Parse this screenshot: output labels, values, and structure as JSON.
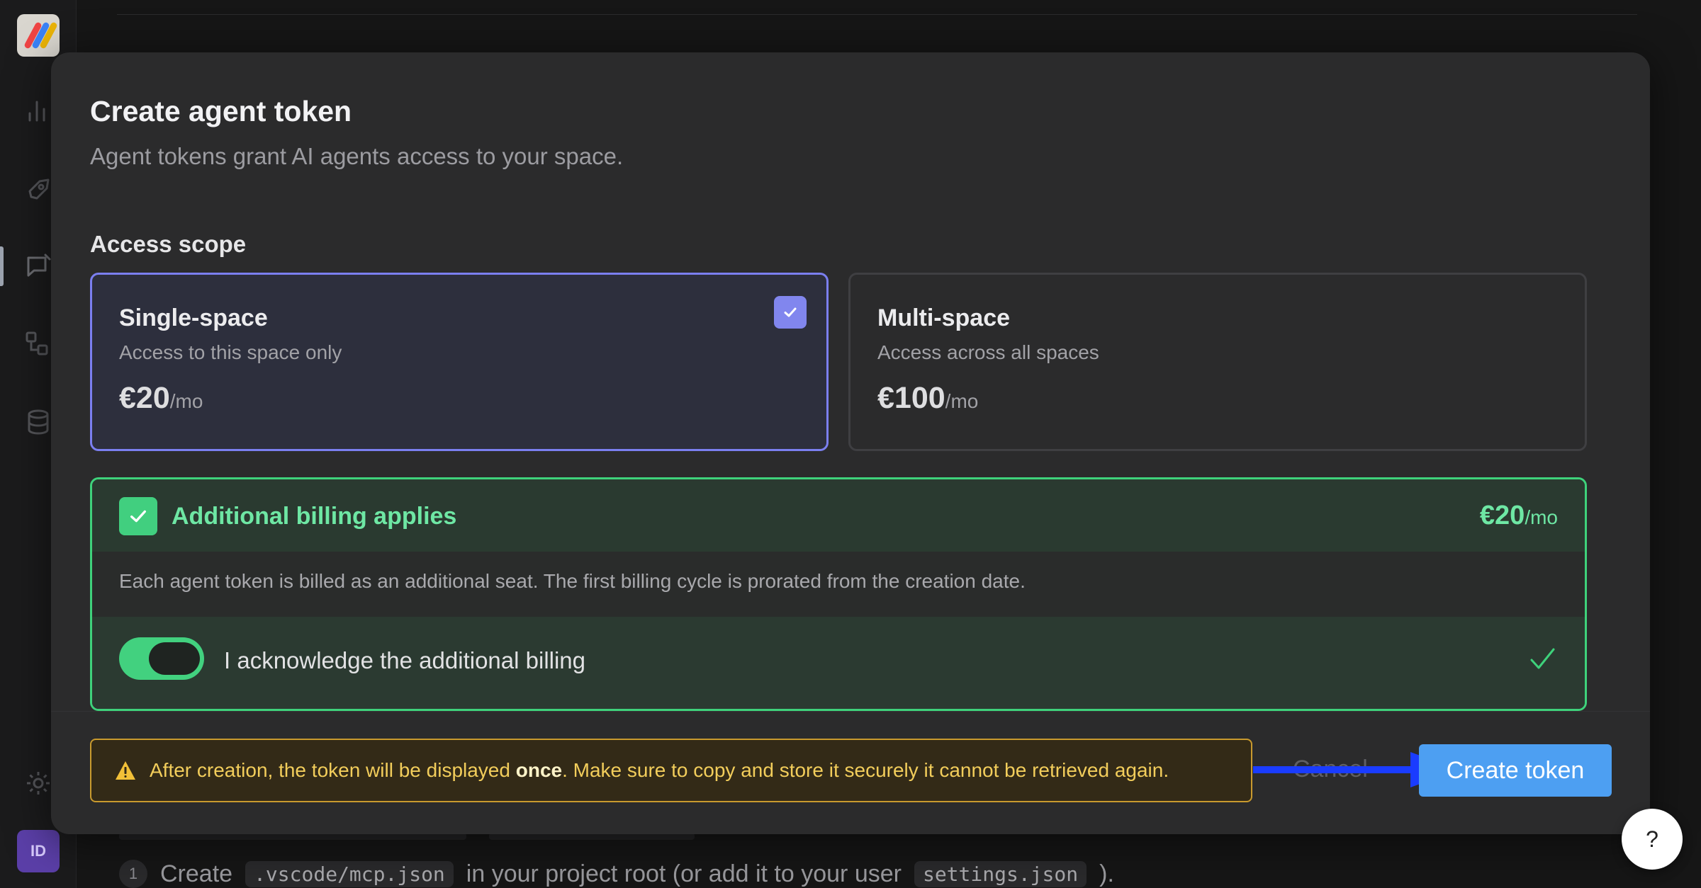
{
  "sidebar": {
    "items": [
      {
        "icon": "bar-chart-icon"
      },
      {
        "icon": "rocket-icon"
      },
      {
        "icon": "chat-icon"
      },
      {
        "icon": "workflow-icon"
      },
      {
        "icon": "database-icon"
      }
    ],
    "settings_icon": "gear-icon",
    "avatar_initials": "ID"
  },
  "background": {
    "step_number": "1",
    "step_text_before": "Create",
    "step_code_1": ".vscode/mcp.json",
    "step_text_middle": "in your project root (or add it to your user",
    "step_code_2": "settings.json",
    "step_text_after": ")."
  },
  "modal": {
    "title": "Create agent token",
    "subtitle": "Agent tokens grant AI agents access to your space.",
    "access_scope_label": "Access scope",
    "scopes": [
      {
        "name": "Single-space",
        "description": "Access to this space only",
        "price": "€20",
        "period": "/mo",
        "selected": true
      },
      {
        "name": "Multi-space",
        "description": "Access across all spaces",
        "price": "€100",
        "period": "/mo",
        "selected": false
      }
    ],
    "billing": {
      "title": "Additional billing applies",
      "price": "€20",
      "period": "/mo",
      "description": "Each agent token is billed as an additional seat. The first billing cycle is prorated from the creation date.",
      "acknowledge_label": "I acknowledge the additional billing",
      "acknowledged": true
    },
    "warning": {
      "text_before": "After creation, the token will be displayed ",
      "text_bold": "once",
      "text_after": ". Make sure to copy and store it securely it cannot be retrieved again."
    },
    "cancel_label": "Cancel",
    "create_label": "Create token"
  },
  "help_label": "?",
  "colors": {
    "accent_purple": "#7b7ff0",
    "success_green": "#3ed27b",
    "primary_blue": "#4d9ff2",
    "warning_amber": "#c99a2e",
    "annotation_arrow": "#1a3cff"
  }
}
